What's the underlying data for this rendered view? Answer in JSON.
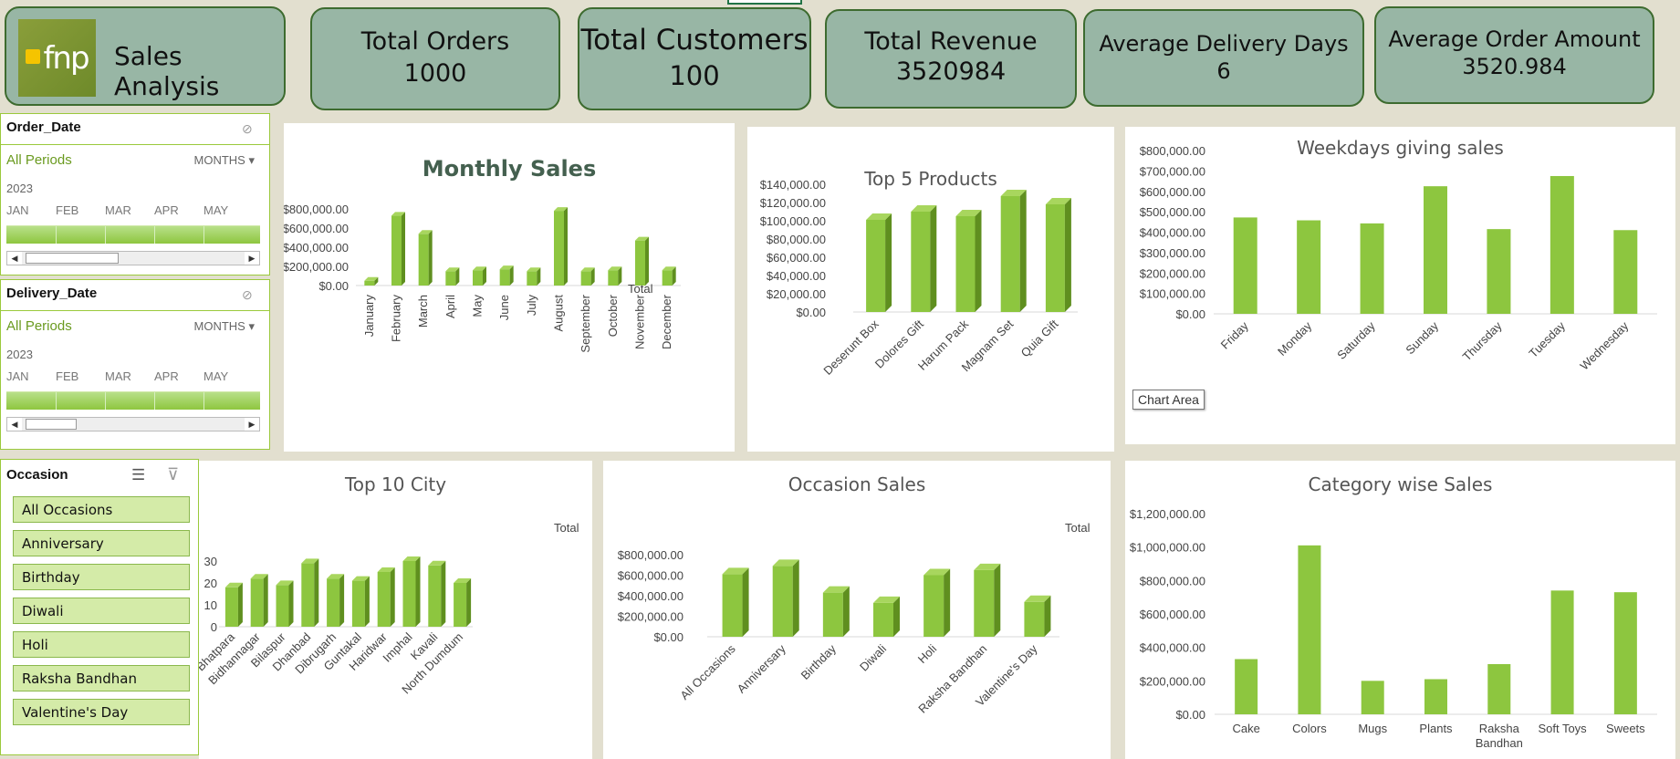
{
  "app": {
    "title": "Sales Analysis",
    "logo_text": "fnp"
  },
  "kpis": {
    "orders": {
      "label": "Total Orders",
      "value": "1000"
    },
    "customers": {
      "label": "Total Customers",
      "value": "100"
    },
    "revenue": {
      "label": "Total Revenue",
      "value": "3520984"
    },
    "delivery": {
      "label": "Average Delivery Days",
      "value": "6"
    },
    "avg_order": {
      "label": "Average Order Amount",
      "value": "3520.984"
    }
  },
  "slicers": {
    "order_date": {
      "title": "Order_Date",
      "period": "All Periods",
      "level": "MONTHS",
      "year": "2023",
      "months": [
        "JAN",
        "FEB",
        "MAR",
        "APR",
        "MAY"
      ]
    },
    "delivery_date": {
      "title": "Delivery_Date",
      "period": "All Periods",
      "level": "MONTHS",
      "year": "2023",
      "months": [
        "JAN",
        "FEB",
        "MAR",
        "APR",
        "MAY"
      ]
    },
    "occasion": {
      "title": "Occasion",
      "items": [
        "All Occasions",
        "Anniversary",
        "Birthday",
        "Diwali",
        "Holi",
        "Raksha Bandhan",
        "Valentine's Day"
      ]
    }
  },
  "tooltip": {
    "chart_area": "Chart Area"
  },
  "colors": {
    "bar": "#8dc63f",
    "bar_side": "#5f8f1f",
    "bar_top": "#a8d65e",
    "kpi_bg": "#98b6a5",
    "kpi_border": "#3d6b2f",
    "bg": "#e2dfcf"
  },
  "chart_data": [
    {
      "id": "monthly",
      "type": "bar",
      "title": "Monthly Sales",
      "legend": "Total",
      "categories": [
        "January",
        "February",
        "March",
        "April",
        "May",
        "June",
        "July",
        "August",
        "September",
        "October",
        "November",
        "December"
      ],
      "values": [
        50000,
        730000,
        540000,
        150000,
        160000,
        170000,
        150000,
        780000,
        150000,
        160000,
        470000,
        160000
      ],
      "yticks": [
        "$0.00",
        "$200,000.00",
        "$400,000.00",
        "$600,000.00",
        "$800,000.00"
      ],
      "ylim": [
        0,
        800000
      ]
    },
    {
      "id": "top5",
      "type": "bar",
      "title": "Top 5 Products",
      "categories": [
        "Deserunt Box",
        "Dolores Gift",
        "Harum Pack",
        "Magnam Set",
        "Quia Gift"
      ],
      "values": [
        101000,
        110000,
        105000,
        127000,
        118000
      ],
      "yticks": [
        "$0.00",
        "$20,000.00",
        "$40,000.00",
        "$60,000.00",
        "$80,000.00",
        "$100,000.00",
        "$120,000.00",
        "$140,000.00"
      ],
      "ylim": [
        0,
        140000
      ]
    },
    {
      "id": "weekday",
      "type": "bar",
      "title": "Weekdays giving sales",
      "categories": [
        "Friday",
        "Monday",
        "Saturday",
        "Sunday",
        "Thursday",
        "Tuesday",
        "Wednesday"
      ],
      "values": [
        472000,
        458000,
        443000,
        625000,
        415000,
        675000,
        410000
      ],
      "yticks": [
        "$0.00",
        "$100,000.00",
        "$200,000.00",
        "$300,000.00",
        "$400,000.00",
        "$500,000.00",
        "$600,000.00",
        "$700,000.00",
        "$800,000.00"
      ],
      "ylim": [
        0,
        800000
      ]
    },
    {
      "id": "city",
      "type": "bar",
      "title": "Top 10 City",
      "legend": "Total",
      "categories": [
        "Bhatpara",
        "Bidhannagar",
        "Bilaspur",
        "Dhanbad",
        "Dibrugarh",
        "Guntakal",
        "Haridwar",
        "Imphal",
        "Kavali",
        "North Dumdum"
      ],
      "values": [
        18,
        22,
        19,
        29,
        22,
        21,
        25,
        30,
        28,
        20
      ],
      "yticks": [
        "0",
        "10",
        "20",
        "30"
      ],
      "ylim": [
        0,
        30
      ]
    },
    {
      "id": "occasion",
      "type": "bar",
      "title": "Occasion Sales",
      "legend": "Total",
      "categories": [
        "All Occasions",
        "Anniversary",
        "Birthday",
        "Diwali",
        "Holi",
        "Raksha Bandhan",
        "Valentine's Day"
      ],
      "values": [
        610000,
        690000,
        430000,
        330000,
        600000,
        650000,
        340000
      ],
      "yticks": [
        "$0.00",
        "$200,000.00",
        "$400,000.00",
        "$600,000.00",
        "$800,000.00"
      ],
      "ylim": [
        0,
        800000
      ]
    },
    {
      "id": "category",
      "type": "bar",
      "title": "Category wise Sales",
      "categories": [
        "Cake",
        "Colors",
        "Mugs",
        "Plants",
        "Raksha Bandhan",
        "Soft Toys",
        "Sweets"
      ],
      "values": [
        330000,
        1010000,
        200000,
        210000,
        300000,
        740000,
        730000
      ],
      "yticks": [
        "$0.00",
        "$200,000.00",
        "$400,000.00",
        "$600,000.00",
        "$800,000.00",
        "$1,000,000.00",
        "$1,200,000.00"
      ],
      "ylim": [
        0,
        1200000
      ]
    }
  ]
}
